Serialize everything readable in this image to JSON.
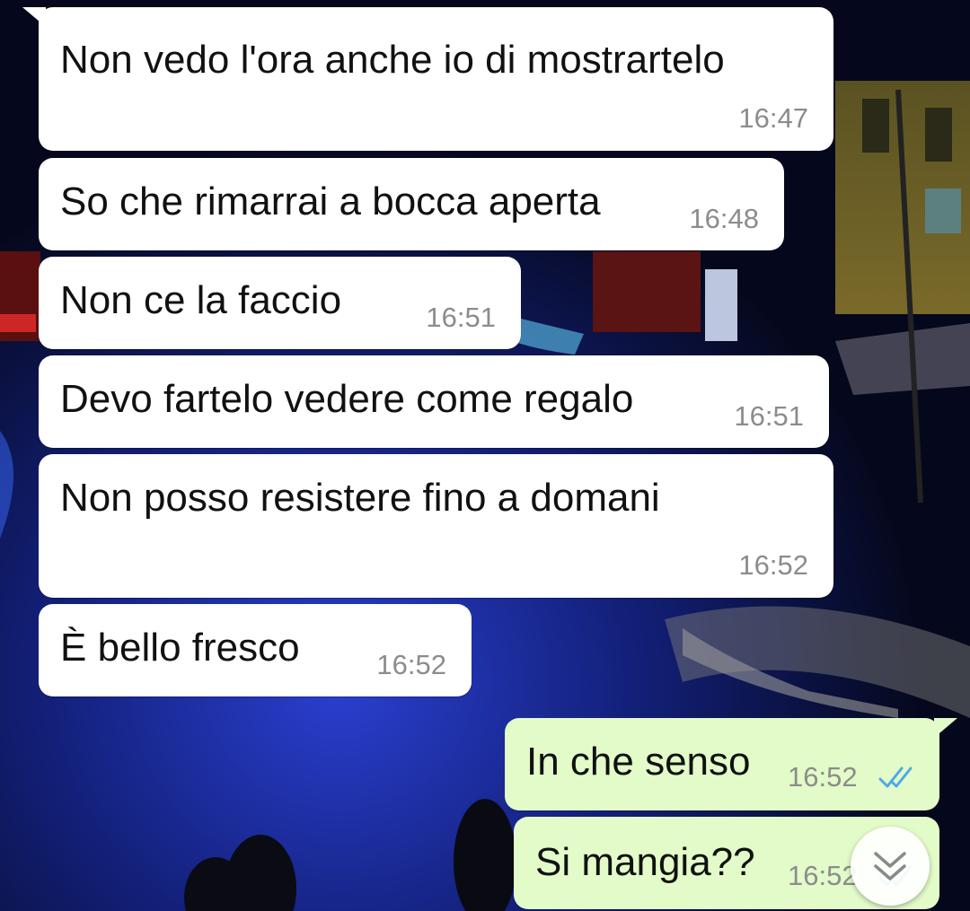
{
  "messages": [
    {
      "text": "Non vedo l'ora anche io di mostrartelo",
      "time": "16:47"
    },
    {
      "text": "So che rimarrai a bocca aperta",
      "time": "16:48"
    },
    {
      "text": "Non ce la faccio",
      "time": "16:51"
    },
    {
      "text": "Devo fartelo vedere come regalo",
      "time": "16:51"
    },
    {
      "text": "Non posso resistere fino a domani",
      "time": "16:52"
    },
    {
      "text": "È bello fresco",
      "time": "16:52"
    },
    {
      "text": "In che senso",
      "time": "16:52",
      "status": "read-ticks-icon"
    },
    {
      "text": "Si mangia??",
      "time": "16:52",
      "status": "read-ticks-icon"
    }
  ],
  "colors": {
    "incoming_bubble": "#ffffff",
    "outgoing_bubble": "#e2fbc9",
    "read_ticks": "#4fa8e8",
    "timestamp": "#8c8c8c"
  }
}
